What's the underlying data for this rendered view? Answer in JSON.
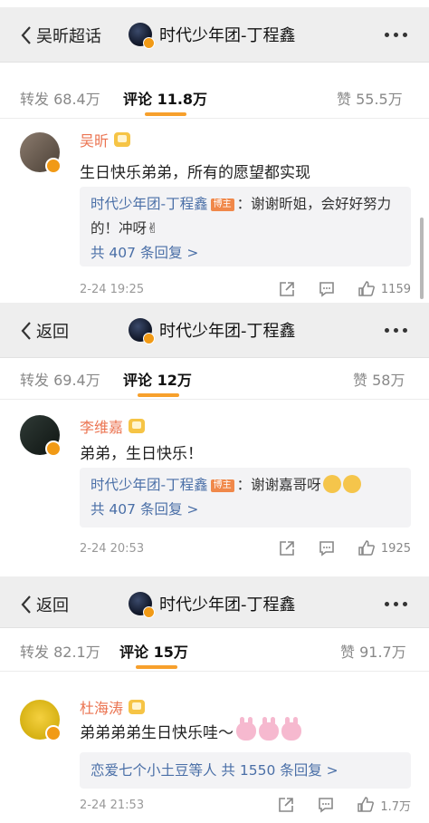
{
  "panels": [
    {
      "nav": {
        "back_label": "吴昕超话",
        "title": "时代少年团-丁程鑫"
      },
      "tabs": {
        "repost": "转发 68.4万",
        "comments": "评论 11.8万",
        "likes": "赞 55.5万"
      },
      "comment": {
        "user": "吴昕",
        "text": "生日快乐弟弟，所有的愿望都实现",
        "reply_user": "时代少年团-丁程鑫",
        "reply_badge": "博主",
        "reply_text": "：谢谢昕姐，会好好努力的！冲呀✌",
        "reply_more": "共 407 条回复 >",
        "time": "2-24 19:25",
        "like_count": "1159"
      }
    },
    {
      "nav": {
        "back_label": "返回",
        "title": "时代少年团-丁程鑫"
      },
      "tabs": {
        "repost": "转发 69.4万",
        "comments": "评论 12万",
        "likes": "赞 58万"
      },
      "comment": {
        "user": "李维嘉",
        "text": "弟弟，生日快乐！",
        "reply_user": "时代少年团-丁程鑫",
        "reply_badge": "博主",
        "reply_text": "：谢谢嘉哥呀",
        "reply_more": "共 407 条回复 >",
        "time": "2-24 20:53",
        "like_count": "1925"
      }
    },
    {
      "nav": {
        "back_label": "返回",
        "title": "时代少年团-丁程鑫"
      },
      "tabs": {
        "repost": "转发 82.1万",
        "comments": "评论 15万",
        "likes": "赞 91.7万"
      },
      "comment": {
        "user": "杜海涛",
        "text": "弟弟弟弟生日快乐哇～",
        "reply_more": "恋爱七个小土豆等人  共 1550 条回复 >",
        "time": "2-24 21:53",
        "like_count": "1.7万"
      }
    }
  ],
  "colors": {
    "accent": "#f7a02c",
    "username": "#eb7350",
    "link": "#4a6fa7",
    "badge": "#f0884a"
  },
  "icons": [
    "chevron-left-icon",
    "more-dots-icon",
    "share-icon",
    "comment-icon",
    "like-icon",
    "verified-icon",
    "crown-icon"
  ]
}
